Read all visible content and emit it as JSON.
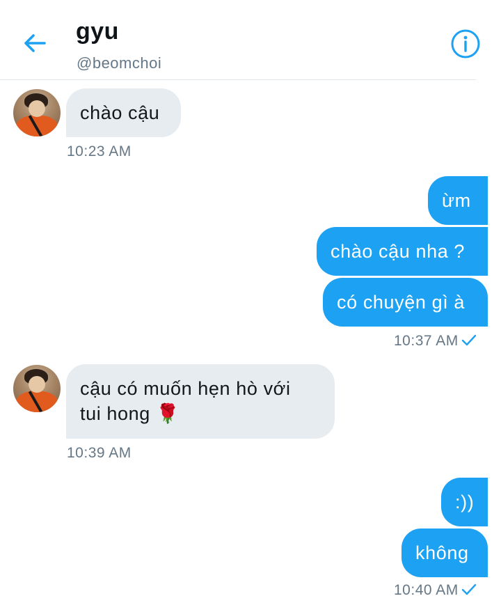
{
  "header": {
    "title": "gyu",
    "handle": "@beomchoi"
  },
  "messages": [
    {
      "text": "chào cậu",
      "time": "10:23 AM"
    },
    {
      "text": "ừm"
    },
    {
      "text": "chào cậu nha ?"
    },
    {
      "text": "có chuyện gì à",
      "time": "10:37 AM"
    },
    {
      "text": "cậu có muốn hẹn hò với tui hong 🌹",
      "line1": "cậu có muốn hẹn hò với",
      "line2": "tui hong 🌹",
      "time": "10:39 AM"
    },
    {
      "text": ":))"
    },
    {
      "text": "không",
      "time": "10:40 AM"
    }
  ],
  "colors": {
    "accent": "#1da1f2",
    "incoming_bubble": "#e6ecf0",
    "muted_text": "#657786"
  },
  "icons": {
    "back": "arrow-left-icon",
    "info": "info-circle-icon",
    "read_receipt": "checkmark-icon"
  }
}
